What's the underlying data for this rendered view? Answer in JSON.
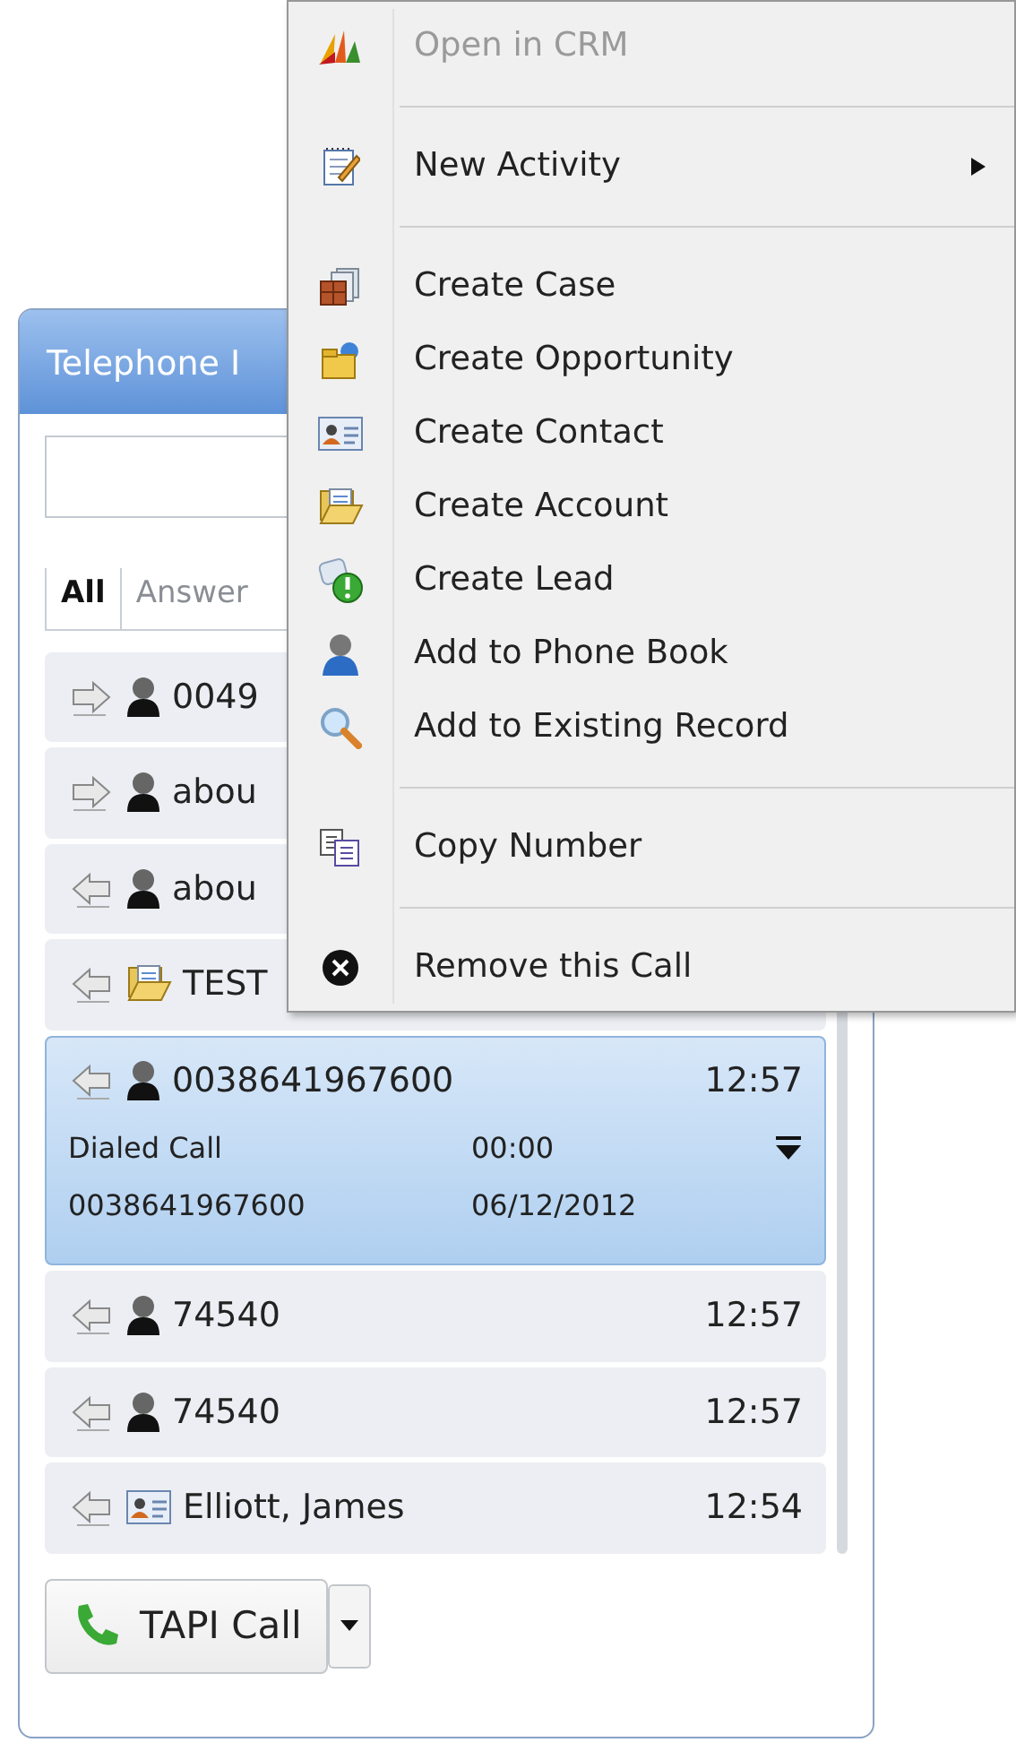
{
  "panel": {
    "title": "Telephone I"
  },
  "tabs": [
    {
      "label": "All",
      "selected": true
    },
    {
      "label": "Answer",
      "selected": false
    }
  ],
  "calls": [
    {
      "outgoing": true,
      "kind": "person",
      "name": "0049",
      "selected": false
    },
    {
      "outgoing": true,
      "kind": "person",
      "name": "abou",
      "selected": false
    },
    {
      "outgoing": false,
      "kind": "person",
      "name": "abou",
      "selected": false
    },
    {
      "outgoing": false,
      "kind": "account",
      "name": "TEST",
      "selected": false
    },
    {
      "outgoing": false,
      "kind": "person",
      "name": "0038641967600",
      "time": "12:57",
      "selected": true,
      "details": {
        "type": "Dialed Call",
        "duration": "00:00",
        "number": "0038641967600",
        "date": "06/12/2012"
      }
    },
    {
      "outgoing": false,
      "kind": "person",
      "name": "74540",
      "time": "12:57",
      "selected": false
    },
    {
      "outgoing": false,
      "kind": "person",
      "name": "74540",
      "time": "12:57",
      "selected": false
    },
    {
      "outgoing": false,
      "kind": "contact",
      "name": "Elliott, James",
      "time": "12:54",
      "selected": false
    }
  ],
  "call_button": {
    "label": "TAPI Call"
  },
  "context_menu": {
    "items": [
      {
        "kind": "item",
        "label": "Open in CRM",
        "disabled": true
      },
      {
        "kind": "separator"
      },
      {
        "kind": "item",
        "label": "New Activity",
        "disabled": false,
        "submenu": true
      },
      {
        "kind": "separator"
      },
      {
        "kind": "item",
        "label": "Create Case",
        "disabled": false
      },
      {
        "kind": "item",
        "label": "Create Opportunity",
        "disabled": false
      },
      {
        "kind": "item",
        "label": "Create Contact",
        "disabled": false
      },
      {
        "kind": "item",
        "label": "Create Account",
        "disabled": false
      },
      {
        "kind": "item",
        "label": "Create Lead",
        "disabled": false
      },
      {
        "kind": "item",
        "label": "Add to Phone Book",
        "disabled": false
      },
      {
        "kind": "item",
        "label": "Add to Existing Record",
        "disabled": false
      },
      {
        "kind": "separator"
      },
      {
        "kind": "item",
        "label": "Copy Number",
        "disabled": false
      },
      {
        "kind": "separator"
      },
      {
        "kind": "item",
        "label": "Remove this Call",
        "disabled": false
      }
    ]
  }
}
